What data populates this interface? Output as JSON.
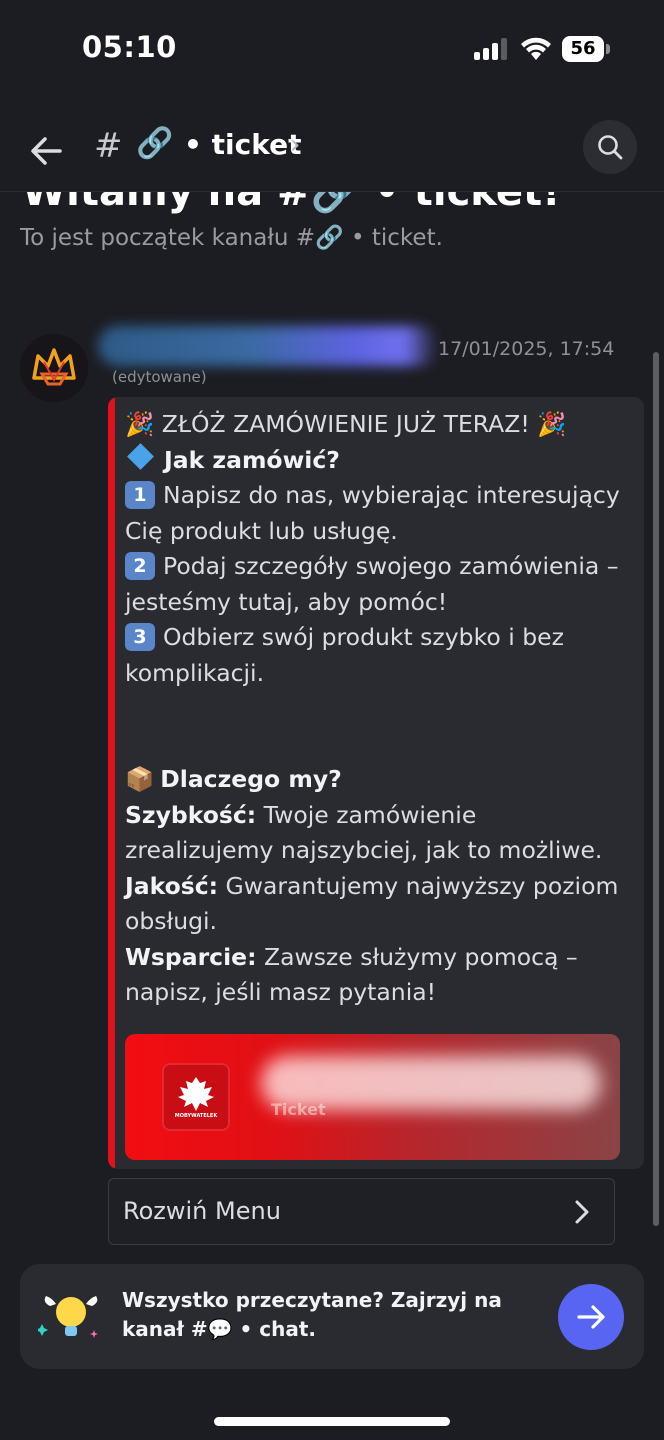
{
  "status_bar": {
    "time": "05:10",
    "battery": "56"
  },
  "header": {
    "hash": "#",
    "channel_emoji": "🔗",
    "channel_name": "• ticket",
    "chevron": "›",
    "icons": {
      "back": "arrow-left-icon",
      "search": "search-icon"
    }
  },
  "welcome": {
    "title_cut": "Witamy na #🔗 • ticket!",
    "subtitle": "To jest początek kanału #🔗 • ticket."
  },
  "message": {
    "timestamp": "17/01/2025, 17:54",
    "edited": "(edytowane)",
    "embed": {
      "accent_color": "#e3101d",
      "title": "🎉 ZŁÓŻ ZAMÓWIENIE JUŻ TERAZ! 🎉",
      "how_heading": "Jak zamówić?",
      "steps": [
        {
          "num": "1",
          "text": "Napisz do nas, wybierając interesujący Cię produkt lub usługę."
        },
        {
          "num": "2",
          "text": "Podaj szczegóły swojego zamówienia – jesteśmy tutaj, aby pomóc!"
        },
        {
          "num": "3",
          "text": "Odbierz swój produkt szybko i bez komplikacji."
        }
      ],
      "why_emoji": "📦",
      "why_heading": "Dlaczego my?",
      "features": [
        {
          "label": "Szybkość:",
          "text": " Twoje zamówienie zrealizujemy najszybciej, jak to możliwe."
        },
        {
          "label": "Jakość:",
          "text": " Gwarantujemy najwyższy poziom obsługi."
        },
        {
          "label": "Wsparcie:",
          "text": " Zawsze służymy pomocą – napisz, jeśli masz pytania!"
        }
      ],
      "image": {
        "emblem_caption": "MOBYWATELEK",
        "label": "Ticket"
      }
    },
    "menu_button": "Rozwiń Menu"
  },
  "read_card": {
    "text": "Wszystko przeczytane? Zajrzyj na kanał #💬 • chat.",
    "button_color": "#5865f2"
  }
}
